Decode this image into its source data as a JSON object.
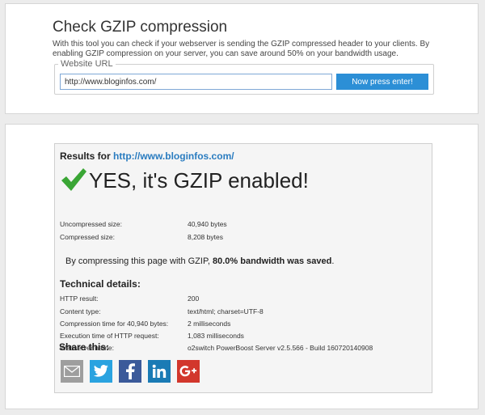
{
  "tool": {
    "title": "Check GZIP compression",
    "description": "With this tool you can check if your webserver is sending the GZIP compressed header to your clients. By enabling GZIP compression on your server, you can save around 50% on your bandwidth usage.",
    "url_legend": "Website URL",
    "url_value": "http://www.bloginfos.com/",
    "submit_label": "Now press enter!"
  },
  "results": {
    "heading_prefix": "Results for",
    "heading_url": "http://www.bloginfos.com/",
    "verdict": "YES, it's GZIP enabled!",
    "sizes": [
      {
        "label": "Uncompressed size:",
        "value": "40,940 bytes"
      },
      {
        "label": "Compressed size:",
        "value": "8,208 bytes"
      }
    ],
    "saved_prefix": "By compressing this page with GZIP,",
    "saved_bold": "80.0% bandwidth was saved",
    "saved_suffix": ".",
    "technical_title": "Technical details:",
    "technical": [
      {
        "label": "HTTP result:",
        "value": "200"
      },
      {
        "label": "Content type:",
        "value": "text/html; charset=UTF-8"
      },
      {
        "label": "Compression time for 40,940 bytes:",
        "value": "2 milliseconds"
      },
      {
        "label": "Execution time of HTTP request:",
        "value": "1,083 milliseconds"
      },
      {
        "label": "Webserver name:",
        "value": "o2switch PowerBoost Server v2.5.566 - Build 160720140908"
      }
    ],
    "share_title": "Share this:",
    "share_buttons": [
      {
        "icon": "email-icon",
        "color": "#9e9e9e"
      },
      {
        "icon": "twitter-icon",
        "color": "#2aa3e0"
      },
      {
        "icon": "facebook-icon",
        "color": "#3b5a9a"
      },
      {
        "icon": "linkedin-icon",
        "color": "#1a7bb5"
      },
      {
        "icon": "google-plus-icon",
        "color": "#d2372c"
      }
    ]
  },
  "colors": {
    "accent": "#2c8fd6",
    "link": "#2a7cc0",
    "check": "#3aa635"
  }
}
